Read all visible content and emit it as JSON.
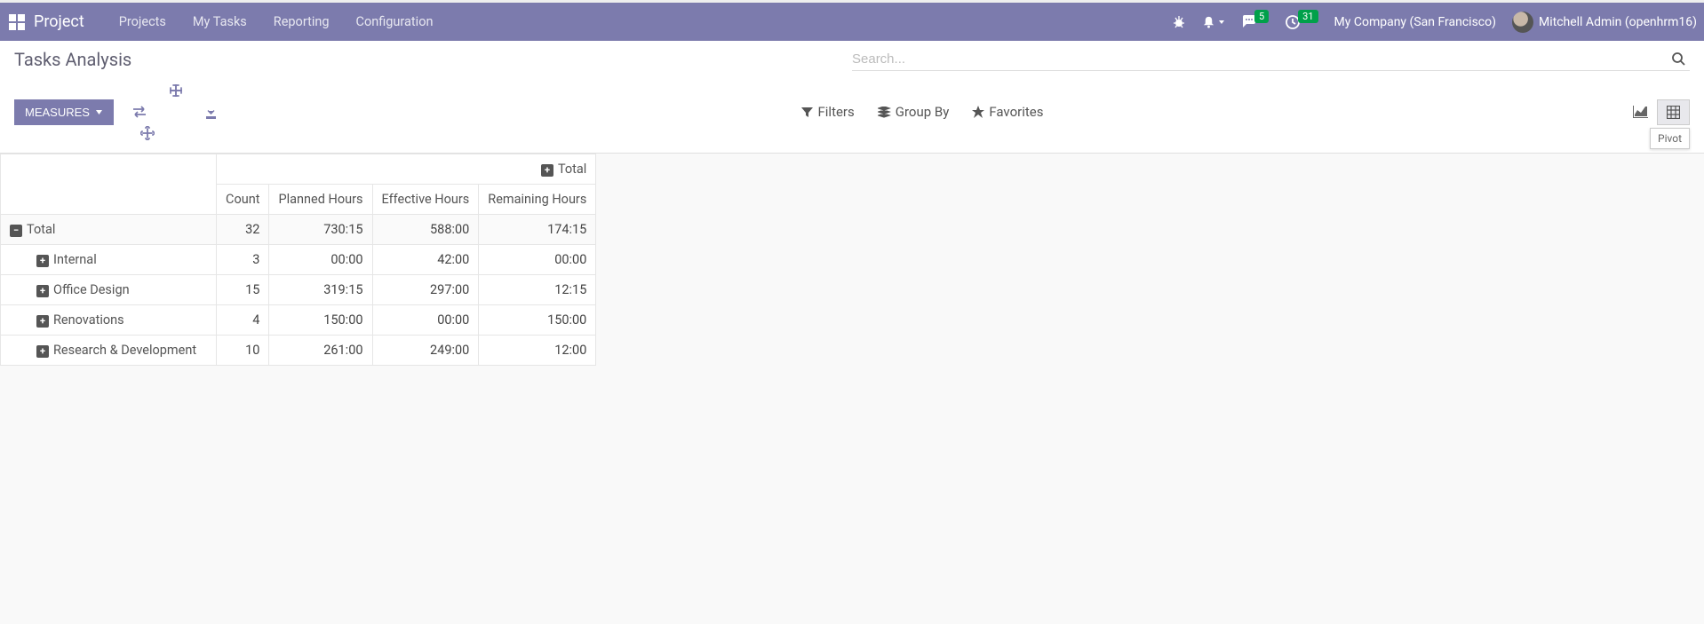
{
  "navbar": {
    "app_name": "Project",
    "menu": [
      "Projects",
      "My Tasks",
      "Reporting",
      "Configuration"
    ],
    "chat_badge": "5",
    "clock_badge": "31",
    "company": "My Company (San Francisco)",
    "user": "Mitchell Admin (openhrm16)"
  },
  "page": {
    "title": "Tasks Analysis",
    "search_placeholder": "Search...",
    "measures_label": "MEASURES",
    "filters_label": "Filters",
    "groupby_label": "Group By",
    "favorites_label": "Favorites",
    "tooltip": "Pivot"
  },
  "pivot": {
    "col_total_label": "Total",
    "row_total_label": "Total",
    "measures": [
      "Count",
      "Planned Hours",
      "Effective Hours",
      "Remaining Hours"
    ],
    "total_row": {
      "count": "32",
      "planned": "730:15",
      "effective": "588:00",
      "remaining": "174:15"
    },
    "rows": [
      {
        "label": "Internal",
        "count": "3",
        "planned": "00:00",
        "effective": "42:00",
        "remaining": "00:00"
      },
      {
        "label": "Office Design",
        "count": "15",
        "planned": "319:15",
        "effective": "297:00",
        "remaining": "12:15"
      },
      {
        "label": "Renovations",
        "count": "4",
        "planned": "150:00",
        "effective": "00:00",
        "remaining": "150:00"
      },
      {
        "label": "Research & Development",
        "count": "10",
        "planned": "261:00",
        "effective": "249:00",
        "remaining": "12:00"
      }
    ]
  }
}
